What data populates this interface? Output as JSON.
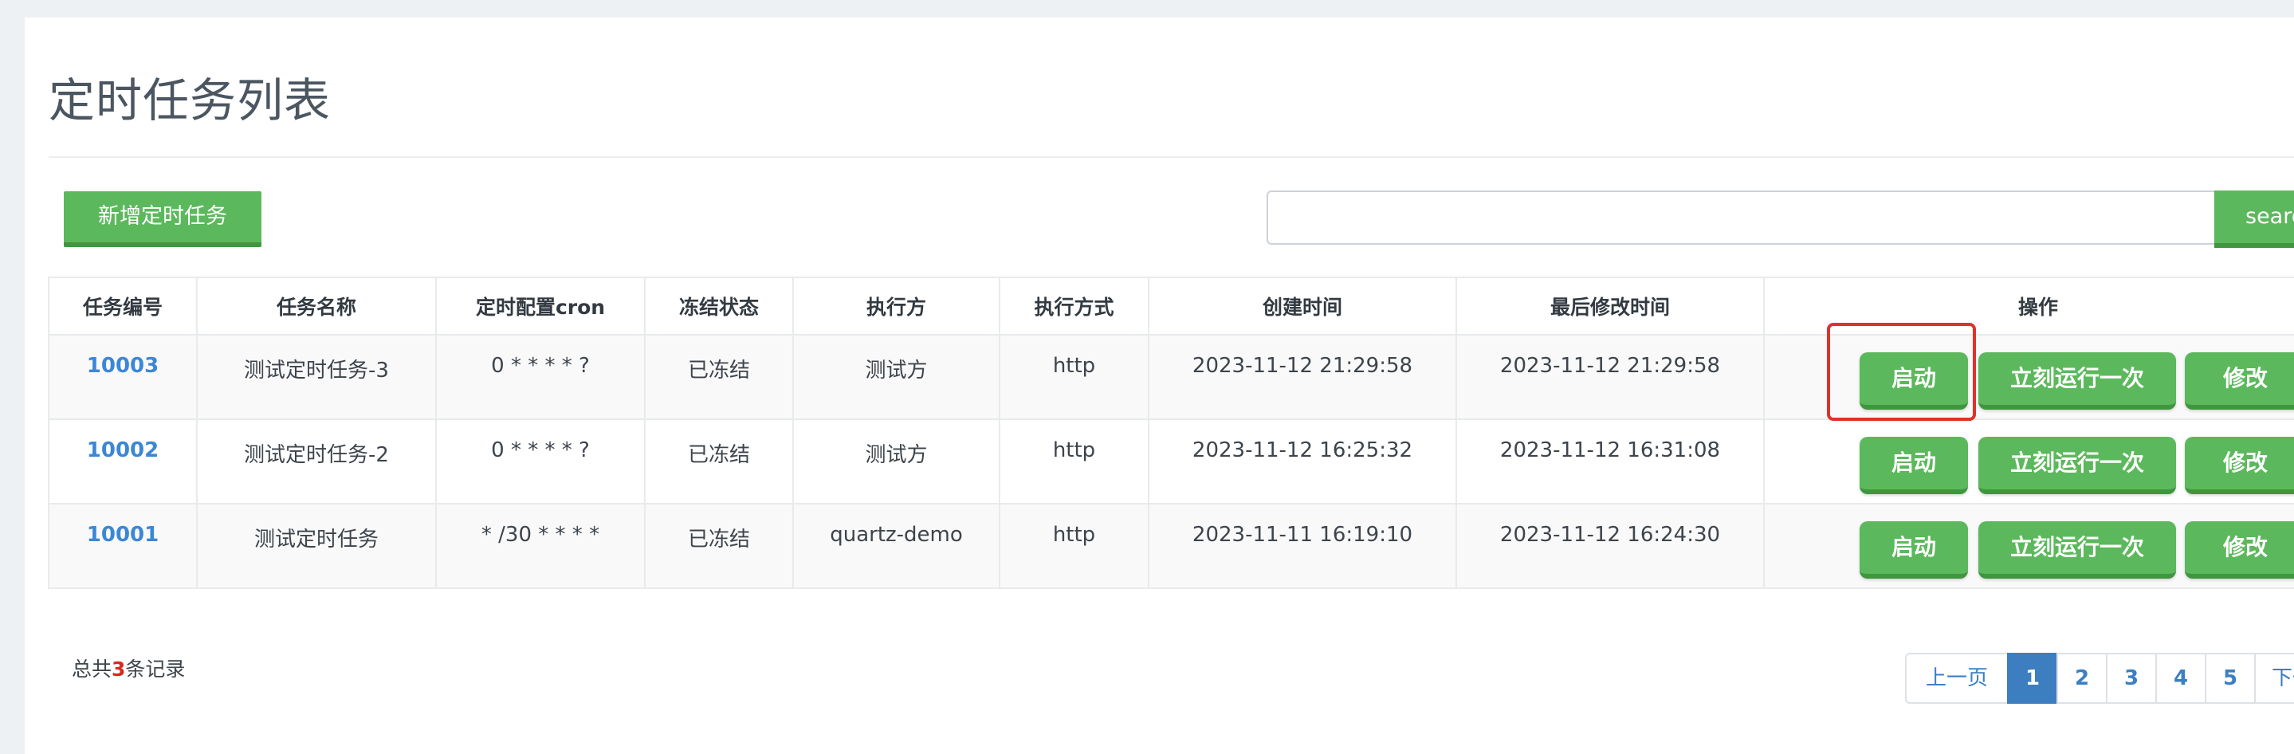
{
  "page": {
    "title": "定时任务列表"
  },
  "toolbar": {
    "add_label": "新增定时任务",
    "search_placeholder": "",
    "search_label": "search"
  },
  "table": {
    "headers": {
      "id": "任务编号",
      "name": "任务名称",
      "cron": "定时配置cron",
      "status": "冻结状态",
      "executor": "执行方",
      "method": "执行方式",
      "created": "创建时间",
      "modified": "最后修改时间",
      "actions": "操作"
    },
    "rows": [
      {
        "id": "10003",
        "name": "测试定时任务-3",
        "cron": "0 * * * * ?",
        "status": "已冻结",
        "executor": "测试方",
        "method": "http",
        "created": "2023-11-12 21:29:58",
        "modified": "2023-11-12 21:29:58"
      },
      {
        "id": "10002",
        "name": "测试定时任务-2",
        "cron": "0 * * * * ?",
        "status": "已冻结",
        "executor": "测试方",
        "method": "http",
        "created": "2023-11-12 16:25:32",
        "modified": "2023-11-12 16:31:08"
      },
      {
        "id": "10001",
        "name": "测试定时任务",
        "cron": "* /30 * * * *",
        "status": "已冻结",
        "executor": "quartz-demo",
        "method": "http",
        "created": "2023-11-11 16:19:10",
        "modified": "2023-11-12 16:24:30"
      }
    ],
    "actions": {
      "start_label": "启动",
      "run_once_label": "立刻运行一次",
      "edit_label": "修改"
    }
  },
  "footer": {
    "total_prefix": "总共",
    "total_count": "3",
    "total_suffix": "条记录"
  },
  "pagination": {
    "prev_label": "上一页",
    "pages": [
      "1",
      "2",
      "3",
      "4",
      "5"
    ],
    "active_page": "1",
    "next_label": "下一页"
  },
  "colors": {
    "primary_green": "#5cb85c",
    "link_blue": "#3b87d6",
    "status_red": "#d9281e",
    "highlight_red": "#e0312a"
  }
}
